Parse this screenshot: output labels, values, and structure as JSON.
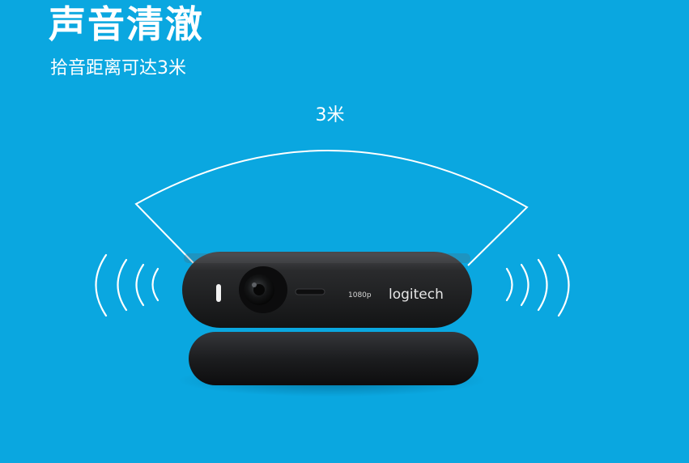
{
  "heading": {
    "title": "声音清澈",
    "subtitle": "拾音距离可达3米"
  },
  "diagram": {
    "range_label": "3米"
  },
  "camera": {
    "brand": "logitech",
    "resolution": "1080p"
  },
  "colors": {
    "background": "#0aa7e0",
    "text": "#ffffff",
    "device_body": "#1e1f21"
  }
}
